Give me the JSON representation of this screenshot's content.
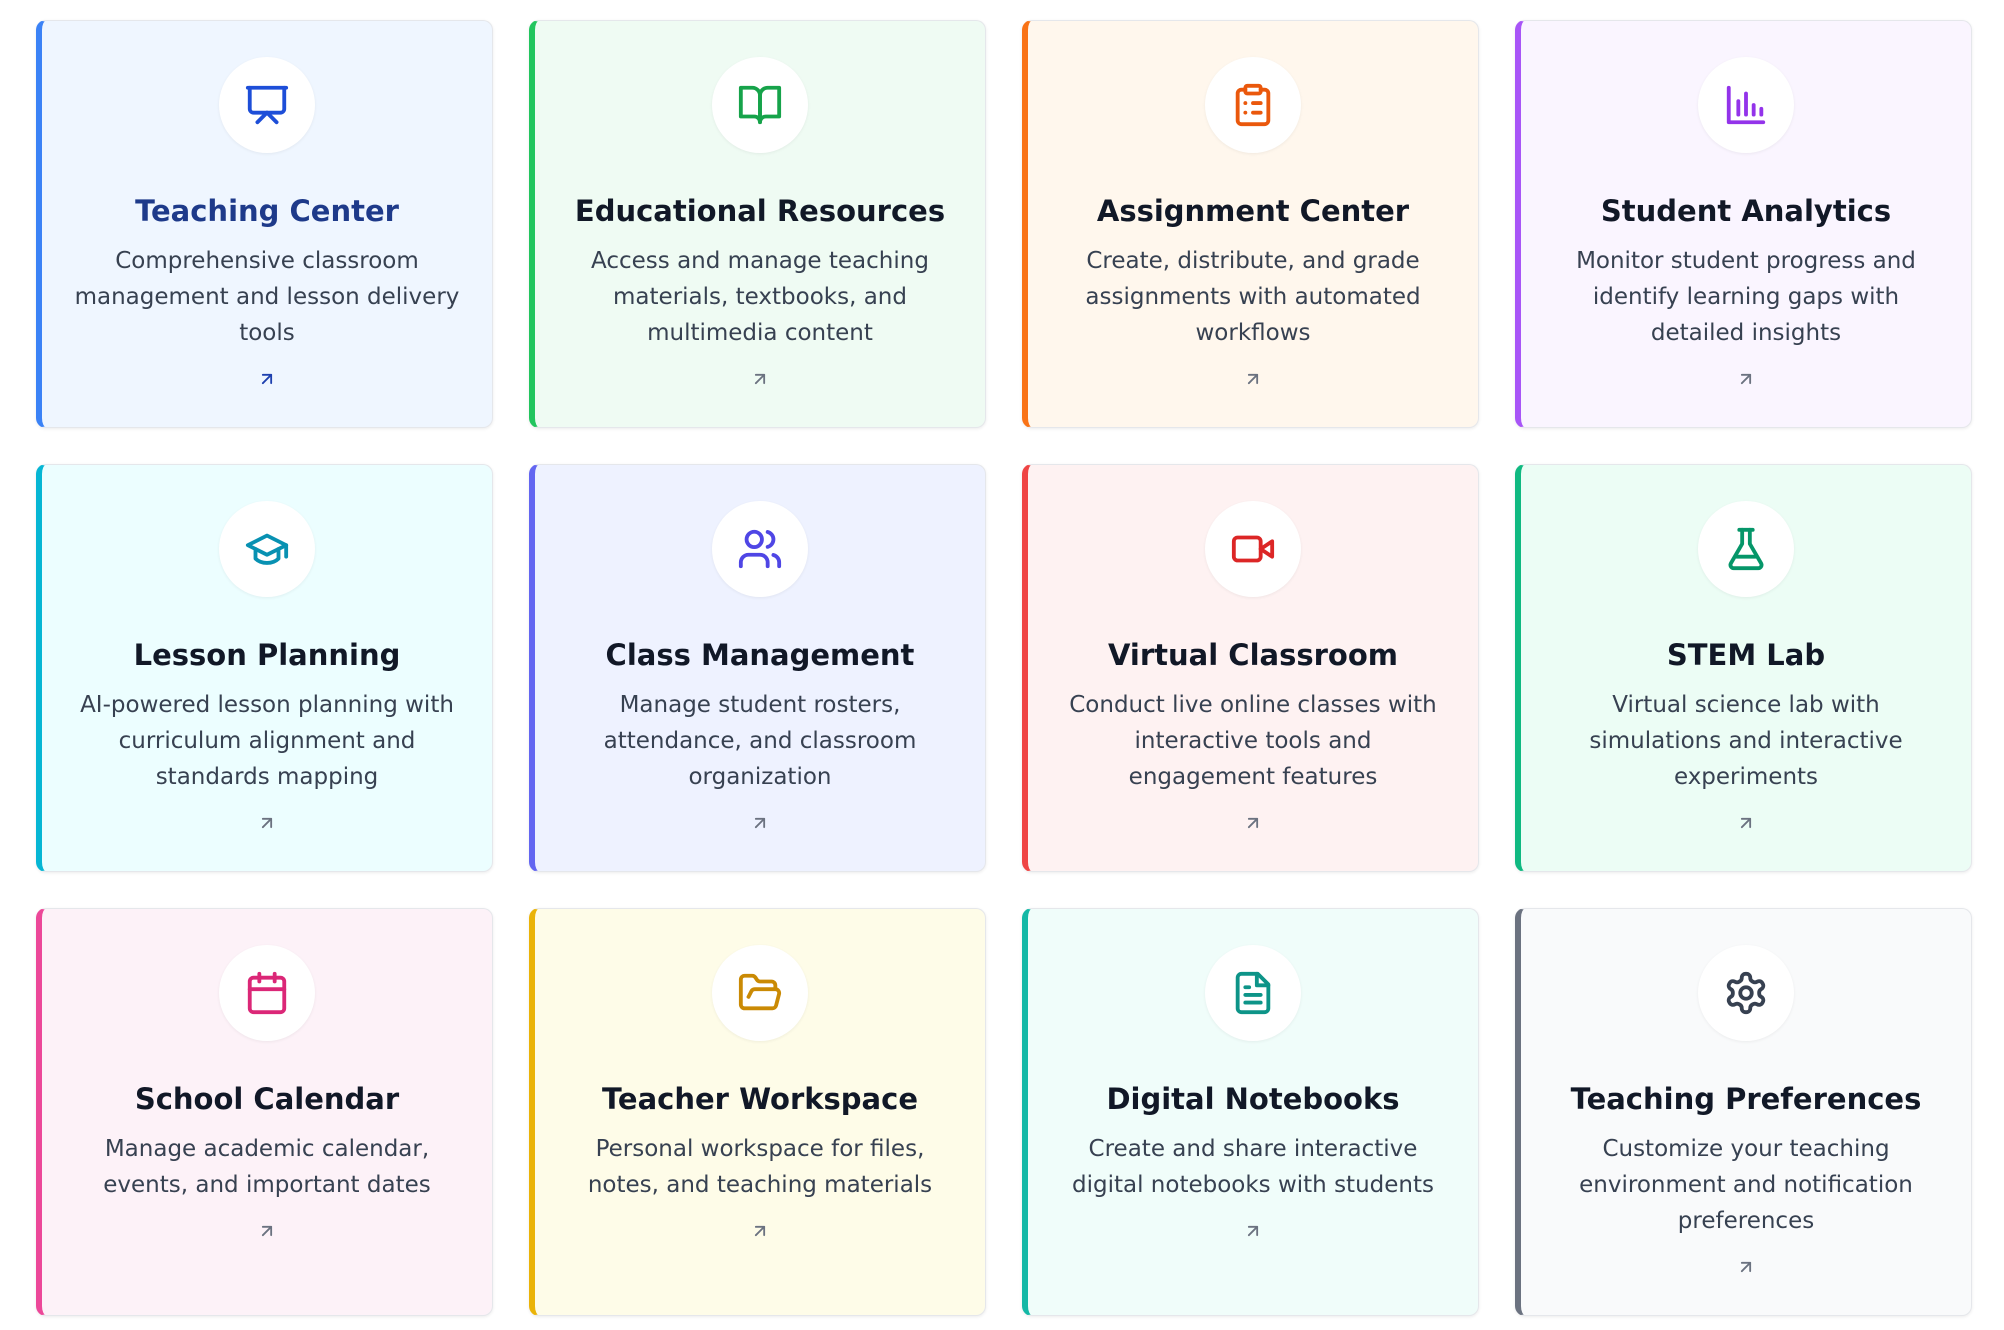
{
  "cards": [
    {
      "title": "Teaching Center",
      "description": "Comprehensive classroom management and lesson delivery tools",
      "icon": "presentation-icon",
      "accent": "#3b82f6",
      "background": "#eff6ff",
      "icon_color": "#1d4ed8"
    },
    {
      "title": "Educational Resources",
      "description": "Access and manage teaching materials, textbooks, and multimedia content",
      "icon": "book-open-icon",
      "accent": "#22c55e",
      "background": "#effbf3",
      "icon_color": "#16a34a"
    },
    {
      "title": "Assignment Center",
      "description": "Create, distribute, and grade assignments with automated workflows",
      "icon": "clipboard-list-icon",
      "accent": "#f97316",
      "background": "#fff7ed",
      "icon_color": "#ea580c"
    },
    {
      "title": "Student Analytics",
      "description": "Monitor student progress and identify learning gaps with detailed insights",
      "icon": "bar-chart-icon",
      "accent": "#a855f7",
      "background": "#faf5ff",
      "icon_color": "#9333ea"
    },
    {
      "title": "Lesson Planning",
      "description": "AI-powered lesson planning with curriculum alignment and standards mapping",
      "icon": "graduation-cap-icon",
      "accent": "#06b6d4",
      "background": "#ecfeff",
      "icon_color": "#0891b2"
    },
    {
      "title": "Class Management",
      "description": "Manage student rosters, attendance, and classroom organization",
      "icon": "users-icon",
      "accent": "#6366f1",
      "background": "#eef2ff",
      "icon_color": "#4f46e5"
    },
    {
      "title": "Virtual Classroom",
      "description": "Conduct live online classes with interactive tools and engagement features",
      "icon": "video-icon",
      "accent": "#ef4444",
      "background": "#fef2f2",
      "icon_color": "#dc2626"
    },
    {
      "title": "STEM Lab",
      "description": "Virtual science lab with simulations and interactive experiments",
      "icon": "flask-icon",
      "accent": "#10b981",
      "background": "#ecfdf5",
      "icon_color": "#059669"
    },
    {
      "title": "School Calendar",
      "description": "Manage academic calendar, events, and important dates",
      "icon": "calendar-icon",
      "accent": "#ec4899",
      "background": "#fdf2f8",
      "icon_color": "#db2777"
    },
    {
      "title": "Teacher Workspace",
      "description": "Personal workspace for files, notes, and teaching materials",
      "icon": "folder-open-icon",
      "accent": "#eab308",
      "background": "#fefce8",
      "icon_color": "#ca8a04"
    },
    {
      "title": "Digital Notebooks",
      "description": "Create and share interactive digital notebooks with students",
      "icon": "file-text-icon",
      "accent": "#14b8a6",
      "background": "#f0fdfa",
      "icon_color": "#0d9488"
    },
    {
      "title": "Teaching Preferences",
      "description": "Customize your teaching environment and notification preferences",
      "icon": "settings-icon",
      "accent": "#6b7280",
      "background": "#f9fafb",
      "icon_color": "#374151"
    }
  ]
}
